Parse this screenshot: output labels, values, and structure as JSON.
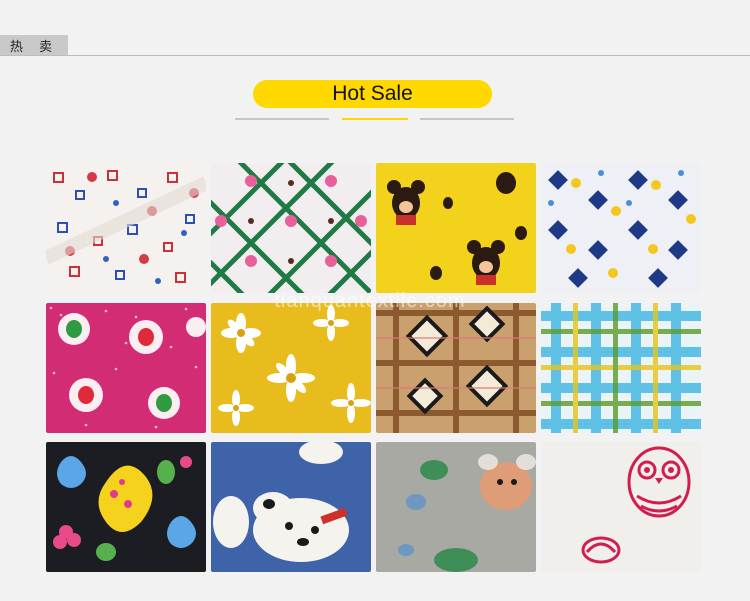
{
  "header": {
    "tab_label": "热 卖"
  },
  "section": {
    "title": "Hot Sale"
  },
  "watermark": "tianquantextile.com",
  "colors": {
    "accent": "#ffd800",
    "background": "#f2f2f2"
  },
  "products": [
    {
      "pattern": "red-flowers-squares-on-white"
    },
    {
      "pattern": "green-lattice-pink-dots"
    },
    {
      "pattern": "mickey-mouse-on-yellow"
    },
    {
      "pattern": "blue-diamonds-yellow-dots"
    },
    {
      "pattern": "fruit-on-pink-dots"
    },
    {
      "pattern": "white-daisies-on-yellow"
    },
    {
      "pattern": "brown-plaid-diamonds"
    },
    {
      "pattern": "blue-green-plaid"
    },
    {
      "pattern": "butterflies-on-black"
    },
    {
      "pattern": "puppy-on-denim-blue"
    },
    {
      "pattern": "cartoon-animals-on-grey"
    },
    {
      "pattern": "pink-owls-on-white"
    }
  ]
}
